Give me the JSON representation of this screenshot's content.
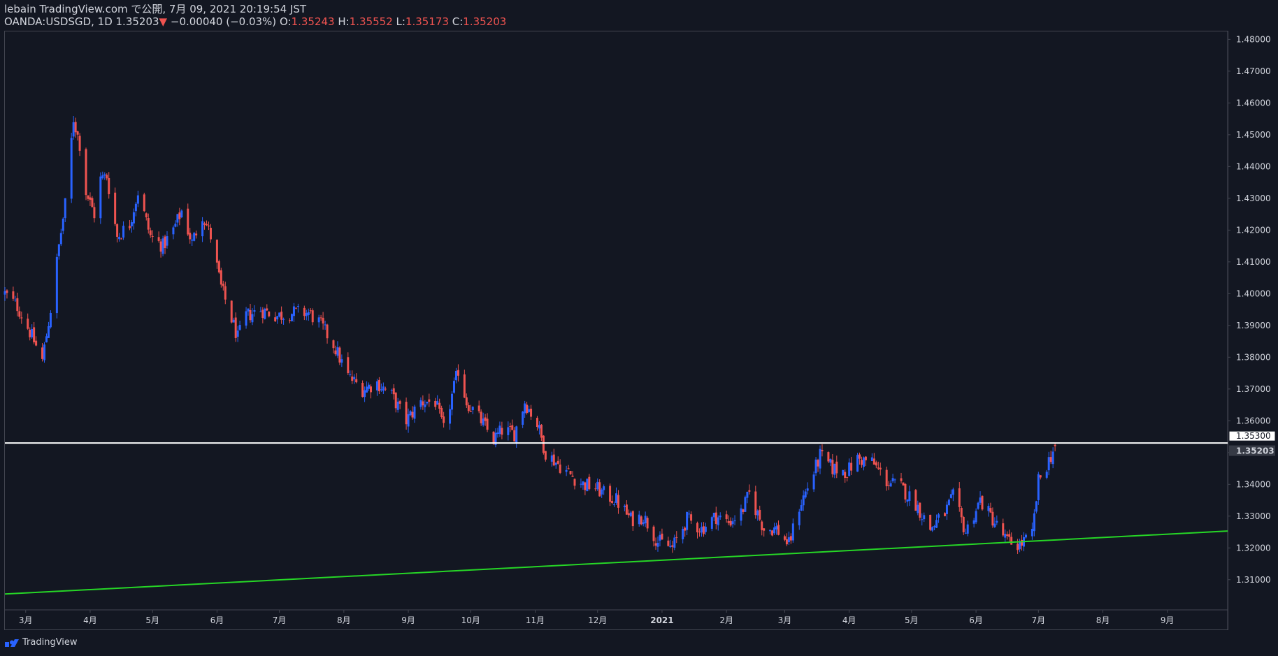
{
  "header": {
    "publish_line": "lebain TradingView.com で公開, 7月 09, 2021 20:19:54 JST",
    "symbol": "OANDA:USDSGD, 1D 1.35203",
    "change_arrow": "▼",
    "change": "−0.00040 (−0.03%)",
    "o_label": "O:",
    "o_value": "1.35243",
    "h_label": "H:",
    "h_value": "1.35552",
    "l_label": "L:",
    "l_value": "1.35173",
    "c_label": "C:",
    "c_value": "1.35203"
  },
  "footer": {
    "brand": "TradingView",
    "logo_icon": "tradingview-logo-icon"
  },
  "colors": {
    "background": "#131722",
    "up": "#2962ff",
    "down": "#ef5350",
    "support_line": "#26d626",
    "level_line": "#ffffff",
    "grid_border": "#434651"
  },
  "chart_data": {
    "type": "candlestick",
    "symbol": "OANDA:USDSGD",
    "interval": "1D",
    "ylim": [
      1.3005,
      1.4825
    ],
    "y_ticks": [
      "1.48000",
      "1.47000",
      "1.46000",
      "1.45000",
      "1.44000",
      "1.43000",
      "1.42000",
      "1.41000",
      "1.40000",
      "1.39000",
      "1.38000",
      "1.37000",
      "1.36000",
      "1.35000",
      "1.34000",
      "1.33000",
      "1.32000",
      "1.31000"
    ],
    "x_ticks": [
      {
        "label": "3月",
        "date": "2020-03-01"
      },
      {
        "label": "4月",
        "date": "2020-04-01"
      },
      {
        "label": "5月",
        "date": "2020-05-01"
      },
      {
        "label": "6月",
        "date": "2020-06-01"
      },
      {
        "label": "7月",
        "date": "2020-07-01"
      },
      {
        "label": "8月",
        "date": "2020-08-01"
      },
      {
        "label": "9月",
        "date": "2020-09-01"
      },
      {
        "label": "10月",
        "date": "2020-10-01"
      },
      {
        "label": "11月",
        "date": "2020-11-01"
      },
      {
        "label": "12月",
        "date": "2020-12-01"
      },
      {
        "label": "2021",
        "date": "2021-01-01",
        "bold": true
      },
      {
        "label": "2月",
        "date": "2021-02-01"
      },
      {
        "label": "3月",
        "date": "2021-03-01"
      },
      {
        "label": "4月",
        "date": "2021-04-01"
      },
      {
        "label": "5月",
        "date": "2021-05-01"
      },
      {
        "label": "6月",
        "date": "2021-06-01"
      },
      {
        "label": "7月",
        "date": "2021-07-01"
      },
      {
        "label": "8月",
        "date": "2021-08-01"
      },
      {
        "label": "9月",
        "date": "2021-09-01"
      }
    ],
    "x_range": [
      "2020-02-20",
      "2021-09-30"
    ],
    "close_path": [
      [
        "2020-02-20",
        1.4
      ],
      [
        "2020-02-26",
        1.396
      ],
      [
        "2020-03-03",
        1.388
      ],
      [
        "2020-03-09",
        1.379
      ],
      [
        "2020-03-13",
        1.395
      ],
      [
        "2020-03-17",
        1.415
      ],
      [
        "2020-03-20",
        1.428
      ],
      [
        "2020-03-24",
        1.455
      ],
      [
        "2020-03-27",
        1.447
      ],
      [
        "2020-03-30",
        1.432
      ],
      [
        "2020-04-03",
        1.425
      ],
      [
        "2020-04-06",
        1.436
      ],
      [
        "2020-04-09",
        1.437
      ],
      [
        "2020-04-14",
        1.418
      ],
      [
        "2020-04-20",
        1.422
      ],
      [
        "2020-04-24",
        1.432
      ],
      [
        "2020-04-30",
        1.418
      ],
      [
        "2020-05-06",
        1.415
      ],
      [
        "2020-05-11",
        1.42
      ],
      [
        "2020-05-15",
        1.426
      ],
      [
        "2020-05-20",
        1.416
      ],
      [
        "2020-05-25",
        1.425
      ],
      [
        "2020-05-29",
        1.418
      ],
      [
        "2020-06-03",
        1.402
      ],
      [
        "2020-06-08",
        1.392
      ],
      [
        "2020-06-11",
        1.386
      ],
      [
        "2020-06-15",
        1.393
      ],
      [
        "2020-06-22",
        1.395
      ],
      [
        "2020-06-30",
        1.393
      ],
      [
        "2020-07-07",
        1.394
      ],
      [
        "2020-07-15",
        1.394
      ],
      [
        "2020-07-20",
        1.391
      ],
      [
        "2020-07-27",
        1.384
      ],
      [
        "2020-08-03",
        1.374
      ],
      [
        "2020-08-10",
        1.37
      ],
      [
        "2020-08-17",
        1.372
      ],
      [
        "2020-08-24",
        1.368
      ],
      [
        "2020-08-31",
        1.36
      ],
      [
        "2020-09-07",
        1.366
      ],
      [
        "2020-09-14",
        1.366
      ],
      [
        "2020-09-18",
        1.357
      ],
      [
        "2020-09-25",
        1.376
      ],
      [
        "2020-09-29",
        1.366
      ],
      [
        "2020-10-06",
        1.36
      ],
      [
        "2020-10-12",
        1.354
      ],
      [
        "2020-10-16",
        1.357
      ],
      [
        "2020-10-22",
        1.356
      ],
      [
        "2020-10-27",
        1.366
      ],
      [
        "2020-11-02",
        1.359
      ],
      [
        "2020-11-06",
        1.35
      ],
      [
        "2020-11-11",
        1.347
      ],
      [
        "2020-11-18",
        1.343
      ],
      [
        "2020-11-24",
        1.34
      ],
      [
        "2020-11-30",
        1.339
      ],
      [
        "2020-12-04",
        1.337
      ],
      [
        "2020-12-10",
        1.335
      ],
      [
        "2020-12-17",
        1.329
      ],
      [
        "2020-12-23",
        1.33
      ],
      [
        "2020-12-30",
        1.322
      ],
      [
        "2021-01-06",
        1.32
      ],
      [
        "2021-01-13",
        1.329
      ],
      [
        "2021-01-20",
        1.326
      ],
      [
        "2021-01-27",
        1.33
      ],
      [
        "2021-02-02",
        1.328
      ],
      [
        "2021-02-08",
        1.331
      ],
      [
        "2021-02-12",
        1.337
      ],
      [
        "2021-02-19",
        1.326
      ],
      [
        "2021-02-25",
        1.326
      ],
      [
        "2021-03-03",
        1.321
      ],
      [
        "2021-03-08",
        1.333
      ],
      [
        "2021-03-14",
        1.342
      ],
      [
        "2021-03-18",
        1.349
      ],
      [
        "2021-03-24",
        1.345
      ],
      [
        "2021-03-31",
        1.344
      ],
      [
        "2021-04-05",
        1.348
      ],
      [
        "2021-04-12",
        1.347
      ],
      [
        "2021-04-19",
        1.341
      ],
      [
        "2021-04-26",
        1.339
      ],
      [
        "2021-05-03",
        1.334
      ],
      [
        "2021-05-10",
        1.326
      ],
      [
        "2021-05-17",
        1.331
      ],
      [
        "2021-05-21",
        1.336
      ],
      [
        "2021-05-27",
        1.325
      ],
      [
        "2021-06-03",
        1.335
      ],
      [
        "2021-06-10",
        1.328
      ],
      [
        "2021-06-16",
        1.322
      ],
      [
        "2021-06-22",
        1.321
      ],
      [
        "2021-06-28",
        1.324
      ],
      [
        "2021-07-01",
        1.341
      ],
      [
        "2021-07-05",
        1.346
      ],
      [
        "2021-07-09",
        1.352
      ]
    ],
    "current_price": "1.35203",
    "horizontal_level": {
      "value": 1.353,
      "label": "1.35300"
    },
    "support_trendline": {
      "start": [
        "2020-02-20",
        1.3055
      ],
      "end": [
        "2021-09-30",
        1.3253
      ]
    }
  }
}
